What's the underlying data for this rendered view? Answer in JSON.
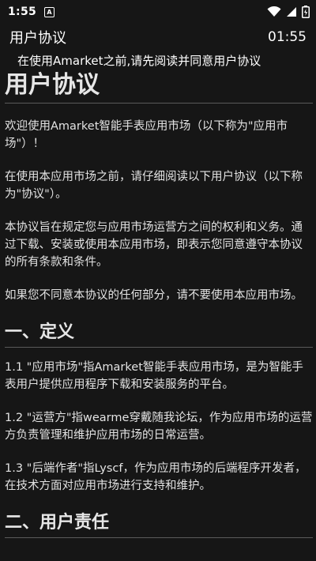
{
  "status_bar": {
    "time": "1:55",
    "notification_badge": "A",
    "icons": [
      "wifi-icon",
      "signal-icon",
      "battery-icon"
    ]
  },
  "app_bar": {
    "title": "用户协议",
    "clock": "01:55"
  },
  "notice": "在使用Amarket之前,请先阅读并同意用户协议",
  "document": {
    "title": "用户协议",
    "intro_paragraphs": [
      "欢迎使用Amarket智能手表应用市场（以下称为\"应用市场\"）！",
      "在使用本应用市场之前，请仔细阅读以下用户协议（以下称为\"协议\"）。",
      "本协议旨在规定您与应用市场运营方之间的权利和义务。通过下载、安装或使用本应用市场，即表示您同意遵守本协议的所有条款和条件。",
      "如果您不同意本协议的任何部分，请不要使用本应用市场。"
    ],
    "section1": {
      "title": "一、定义",
      "items": [
        "1.1 \"应用市场\"指Amarket智能手表应用市场，是为智能手表用户提供应用程序下载和安装服务的平台。",
        "1.2 \"运营方\"指wearme穿戴随我论坛，作为应用市场的运营方负责管理和维护应用市场的日常运营。",
        "1.3 \"后端作者\"指Lyscf，作为应用市场的后端程序开发者，在技术方面对应用市场进行支持和维护。"
      ]
    },
    "section2": {
      "title": "二、用户责任"
    }
  }
}
